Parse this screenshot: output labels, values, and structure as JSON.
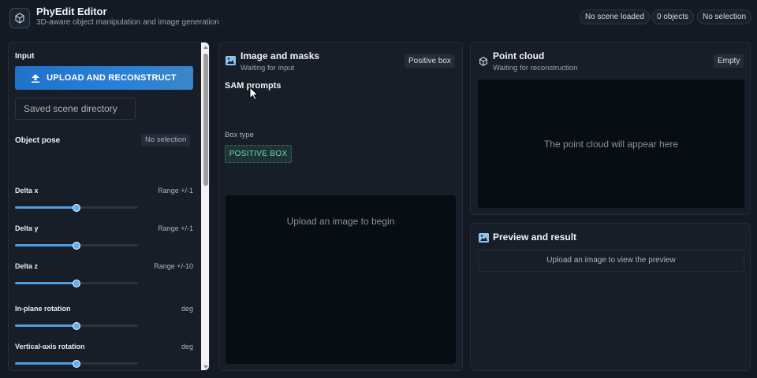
{
  "header": {
    "title": "PhyEdit Editor",
    "subtitle": "3D-aware object manipulation and image generation",
    "status": {
      "scene": "No scene loaded",
      "objects": "0 objects",
      "selection": "No selection"
    }
  },
  "left_panel": {
    "input_label": "Input",
    "upload_button": "UPLOAD AND RECONSTRUCT",
    "saved_scene_placeholder": "Saved scene directory",
    "object_pose_label": "Object pose",
    "object_pose_badge": "No selection",
    "sliders": [
      {
        "label": "Delta x",
        "range": "Range +/-1",
        "value": 0.5
      },
      {
        "label": "Delta y",
        "range": "Range +/-1",
        "value": 0.5
      },
      {
        "label": "Delta z",
        "range": "Range +/-10",
        "value": 0.5
      },
      {
        "label": "In-plane rotation",
        "range": "deg",
        "value": 0.5
      },
      {
        "label": "Vertical-axis rotation",
        "range": "deg",
        "value": 0.5
      }
    ]
  },
  "image_panel": {
    "title": "Image and masks",
    "subtitle": "Waiting for input",
    "tag": "Positive box",
    "sam_prompts": "SAM prompts",
    "box_type_label": "Box type",
    "box_type_value": "POSITIVE BOX",
    "dropzone_text": "Upload an image to begin"
  },
  "cloud_panel": {
    "title": "Point cloud",
    "subtitle": "Waiting for reconstruction",
    "tag": "Empty",
    "placeholder": "The point cloud will appear here"
  },
  "preview_panel": {
    "title": "Preview and result",
    "placeholder": "Upload an image to view the preview"
  },
  "icons": {
    "logo": "cube-3d-icon",
    "upload": "upload-icon",
    "image": "image-icon",
    "point_cloud": "cube-3d-icon",
    "preview": "image-icon"
  },
  "colors": {
    "accent": "#2a80d6",
    "positive": "#66e0a2",
    "background": "#141a23"
  }
}
